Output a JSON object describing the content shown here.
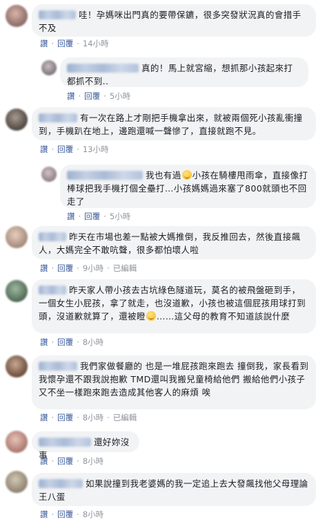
{
  "actions": {
    "like": "讚",
    "reply": "回覆",
    "separator": "·"
  },
  "comments": [
    {
      "text": "哇！孕媽咪出門真的要帶保鑣，很多突發狀況真的會措手不及",
      "time": "14小時",
      "edited": ""
    },
    {
      "text": "真的！馬上就宮縮，想抓那小孩起來打都抓不到..",
      "time": "5小時",
      "edited": ""
    },
    {
      "text": "有一次在路上才剛把手機拿出來，就被兩個死小孩亂衝撞到，手機趴在地上，邊跑還喊一聲慘了，直接就跑不見。",
      "time": "13小時",
      "edited": ""
    },
    {
      "text_a": "我也有過",
      "text_b": "小孩在騎樓甩雨傘，直接像打棒球把我手機打個全壘打…小孩媽媽過來塞了800就頭也不回走了",
      "time": "5小時",
      "edited": ""
    },
    {
      "text": "昨天在市場也差一點被大媽推倒，我反推回去，然後直接飆人，大媽完全不敢吭聲，很多都怕壞人啦",
      "time": "9小時",
      "edited": "已編輯"
    },
    {
      "text_a": "昨天家人帶小孩去古坑綠色隧道玩，莫名的被飛盤砸到手，一個女生小屁孩，拿了就走，也沒道歉，小孩也被這個屁孩用球打到頭，沒道歉就算了，還被瞪",
      "text_b": "……這父母的教育不知道該說什麼",
      "time": "8小時",
      "edited": ""
    },
    {
      "text": "我們家做餐廳的 也是一堆屁孩跑來跑去 撞倒我，家長看到我懷孕還不跟我說抱歉 TMD還叫我搬兒童椅給他們 搬給他們小孩子又不坐一樣跑來跑去造成其他客人的麻煩 唉",
      "time": "8小時",
      "edited": "已編輯"
    },
    {
      "text": "還好妳沒事",
      "time": "8小時",
      "edited": ""
    },
    {
      "text": "如果說撞到我老婆媽的我一定追上去大發飆找他父母理論王八蛋",
      "time": "8小時",
      "edited": ""
    }
  ],
  "colors": {
    "link": "#385898",
    "muted": "#90949c",
    "bubble": "#f2f3f5"
  }
}
